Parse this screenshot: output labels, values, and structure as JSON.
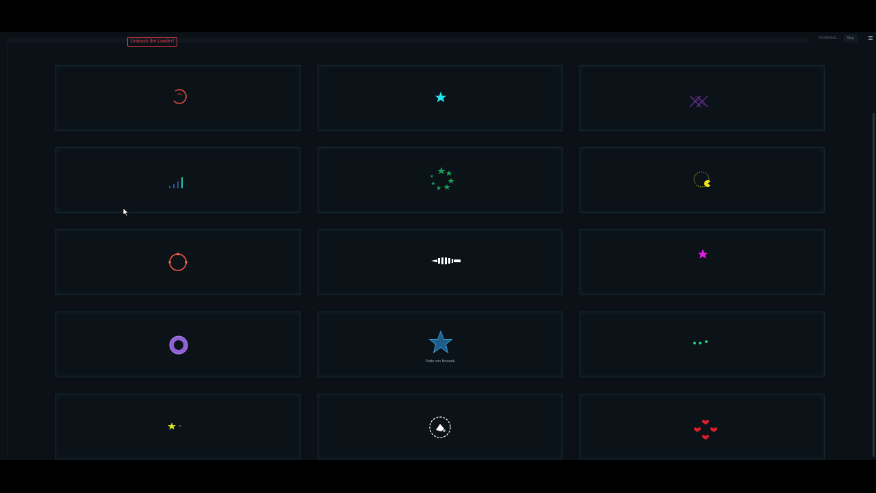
{
  "header": {
    "unleash_label": "Unleash the Loader!",
    "status_text": "RUNNING...",
    "stop_label": "Stop"
  },
  "cards": [
    {
      "name": "red-spinner-arc",
      "color": "#e8503e",
      "caption": ""
    },
    {
      "name": "cyan-star",
      "color": "#27e2ea",
      "caption": ""
    },
    {
      "name": "purple-crossed-lines",
      "color": "#7e3ab3",
      "caption": ""
    },
    {
      "name": "signal-bars",
      "color": "#2aa3b8",
      "caption": ""
    },
    {
      "name": "green-star-ring",
      "color": "#1aa15a",
      "caption": ""
    },
    {
      "name": "yellow-pacman-orbit",
      "color": "#f0e51a",
      "caption": ""
    },
    {
      "name": "red-orbit-ring",
      "color": "#e8503e",
      "caption": ""
    },
    {
      "name": "white-zipper",
      "color": "#ffffff",
      "caption": ""
    },
    {
      "name": "magenta-star",
      "color": "#e21ee8",
      "caption": ""
    },
    {
      "name": "purple-donut",
      "color": "#8e5fd6",
      "caption": ""
    },
    {
      "name": "blue-star-loader",
      "color": "#2a7fb0",
      "caption": "Pade win Broaatk"
    },
    {
      "name": "green-dots",
      "color": "#22d67a",
      "caption": ""
    },
    {
      "name": "yellow-star-blink",
      "color": "#d9e21e",
      "caption": ""
    },
    {
      "name": "white-dashed-circle",
      "color": "#ffffff",
      "caption": ""
    },
    {
      "name": "red-hearts",
      "color": "#d9202a",
      "caption": ""
    }
  ]
}
